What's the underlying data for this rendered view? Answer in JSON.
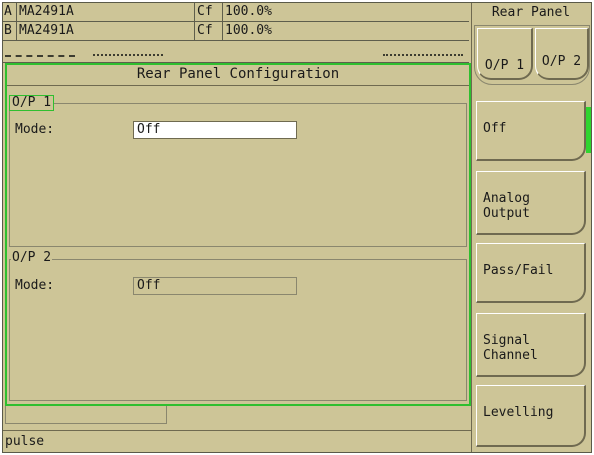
{
  "status": {
    "channels": [
      {
        "letter": "A",
        "sensor": "MA2491A",
        "cf_label": "Cf",
        "cf_value": "100.0%"
      },
      {
        "letter": "B",
        "sensor": "MA2491A",
        "cf_label": "Cf",
        "cf_value": "100.0%"
      }
    ]
  },
  "side_panel": {
    "title": "Rear Panel",
    "tabs": [
      {
        "label": "O/P 1"
      },
      {
        "label": "O/P 2"
      }
    ],
    "softkeys": [
      {
        "label": "Off"
      },
      {
        "label": "Analog\nOutput"
      },
      {
        "label": "Pass/Fail"
      },
      {
        "label": "Signal\nChannel"
      },
      {
        "label": "Levelling"
      }
    ]
  },
  "dialog": {
    "title": "Rear Panel Configuration",
    "groups": [
      {
        "label": "O/P 1",
        "mode_label": "Mode:",
        "mode_value": "Off"
      },
      {
        "label": "O/P 2",
        "mode_label": "Mode:",
        "mode_value": "Off"
      }
    ]
  },
  "footer": {
    "message": "pulse"
  },
  "colors": {
    "background": "#cdc597",
    "accent": "#2fd52f",
    "border_dark": "#6f6a50"
  }
}
